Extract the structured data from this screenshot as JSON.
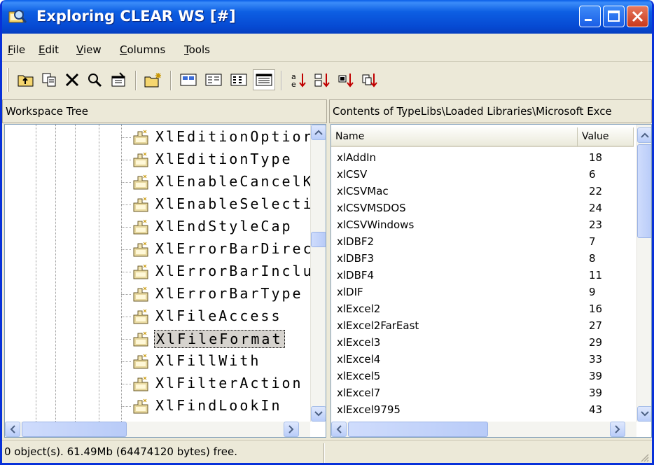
{
  "window": {
    "title": "Exploring CLEAR WS [#]"
  },
  "menu": [
    "File",
    "Edit",
    "View",
    "Columns",
    "Tools"
  ],
  "toolbar": {
    "icons": [
      "up-folder-icon",
      "copy-icon",
      "delete-icon",
      "find-icon",
      "properties-icon",
      "new-folder-icon",
      "large-icons-view-icon",
      "small-icons-view-icon",
      "list-view-icon",
      "details-view-icon",
      "sort-by-name-icon",
      "sort-by-type-icon",
      "sort-by-size-icon",
      "sort-by-date-icon"
    ]
  },
  "tree": {
    "header": "Workspace Tree",
    "items": [
      "XlEditionOptior",
      "XlEditionType",
      "XlEnableCancelK",
      "XlEnableSelecti",
      "XlEndStyleCap",
      "XlErrorBarDirec",
      "XlErrorBarInclu",
      "XlErrorBarType",
      "XlFileAccess",
      "XlFileFormat",
      "XlFillWith",
      "XlFilterAction",
      "XlFindLookIn"
    ],
    "selected_index": 9
  },
  "list": {
    "header": "Contents of TypeLibs\\Loaded Libraries\\Microsoft Exce",
    "columns": [
      "Name",
      "Value"
    ],
    "rows": [
      [
        "xlAddIn",
        "18"
      ],
      [
        "xlCSV",
        "6"
      ],
      [
        "xlCSVMac",
        "22"
      ],
      [
        "xlCSVMSDOS",
        "24"
      ],
      [
        "xlCSVWindows",
        "23"
      ],
      [
        "xlDBF2",
        "7"
      ],
      [
        "xlDBF3",
        "8"
      ],
      [
        "xlDBF4",
        "11"
      ],
      [
        "xlDIF",
        "9"
      ],
      [
        "xlExcel2",
        "16"
      ],
      [
        "xlExcel2FarEast",
        "27"
      ],
      [
        "xlExcel3",
        "29"
      ],
      [
        "xlExcel4",
        "33"
      ],
      [
        "xlExcel5",
        "39"
      ],
      [
        "xlExcel7",
        "39"
      ],
      [
        "xlExcel9795",
        "43"
      ]
    ]
  },
  "status": {
    "text": "0 object(s). 61.49Mb (64474120 bytes) free."
  },
  "colors": {
    "title_bar": "#0a5ee8",
    "close_button": "#e04a2c",
    "window_bg": "#ece9d8"
  }
}
